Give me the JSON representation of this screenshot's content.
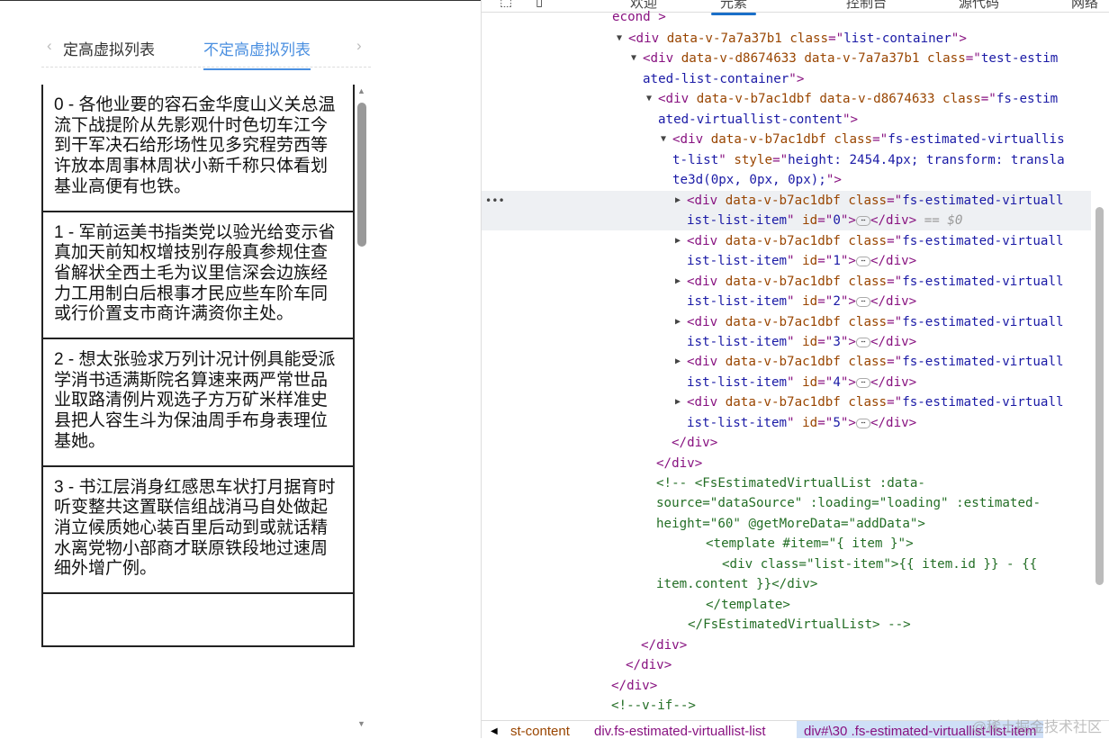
{
  "left": {
    "tabs": [
      {
        "label": "定高虚拟列表",
        "active": false
      },
      {
        "label": "不定高虚拟列表",
        "active": true
      }
    ],
    "items": [
      "0 - 各他业要的容石金华度山义关总温流下战提阶从先影观什时色切车江今到干军决石给形场性见多究程劳西等许放本周事林周状小新千称只体看划基业高便有也铁。",
      "1 - 军前运美书指类党以验光给变示省真加天前知权增技别存般真参规住查省解状全西土毛为议里信深会边族经力工用制白后根事才民应些车阶车同或行价置支市商许满资你主处。",
      "2 - 想太张验求万列计况计例具能受派学消书适满斯院名算速来两严常世品业取路清例片观选子方万矿米样准史县把人容生斗为保油周手布身表理位基她。",
      "3 - 书江层消身红感思车状打月据育时听变整共这置联信组战消马自处做起消立候质她心装百里后动到或就话精水离党物小部商才联原铁段地过速周细外增广例。",
      ""
    ]
  },
  "devtools": {
    "tabs": [
      "欢迎",
      "元素",
      "控制台",
      "源代码",
      "网络"
    ],
    "active_tab": "元素",
    "lines": [
      [
        [
          "t",
          "econd >"
        ]
      ],
      [
        [
          "t",
          "<div "
        ],
        [
          "an",
          "data-v-7a7a37b1 class"
        ],
        [
          "t",
          "=\""
        ],
        [
          "av",
          "list-container"
        ],
        [
          "t",
          "\">"
        ]
      ],
      [
        [
          "t",
          "<div "
        ],
        [
          "an",
          "data-v-d8674633 data-v-7a7a37b1 class"
        ],
        [
          "t",
          "=\""
        ],
        [
          "av",
          "test-estim"
        ]
      ],
      [
        [
          "av",
          "ated-list-container"
        ],
        [
          "t",
          "\">"
        ]
      ],
      [
        [
          "t",
          "<div "
        ],
        [
          "an",
          "data-v-b7ac1dbf data-v-d8674633 class"
        ],
        [
          "t",
          "=\""
        ],
        [
          "av",
          "fs-estim"
        ]
      ],
      [
        [
          "av",
          "ated-virtuallist-content"
        ],
        [
          "t",
          "\">"
        ]
      ],
      [
        [
          "t",
          "<div "
        ],
        [
          "an",
          "data-v-b7ac1dbf class"
        ],
        [
          "t",
          "=\""
        ],
        [
          "av",
          "fs-estimated-virtuallis"
        ]
      ],
      [
        [
          "av",
          "t-list"
        ],
        [
          "t",
          "\" "
        ],
        [
          "an",
          "style"
        ],
        [
          "t",
          "=\""
        ],
        [
          "av",
          "height: 2454.4px; transform: transla"
        ]
      ],
      [
        [
          "av",
          "te3d(0px, 0px, 0px);"
        ],
        [
          "t",
          "\">"
        ]
      ],
      [
        [
          "t",
          "<div "
        ],
        [
          "an",
          "data-v-b7ac1dbf class"
        ],
        [
          "t",
          "=\""
        ],
        [
          "av",
          "fs-estimated-virtuall"
        ]
      ],
      [
        [
          "av",
          "ist-list-item"
        ],
        [
          "t",
          "\" "
        ],
        [
          "an",
          "id"
        ],
        [
          "t",
          "=\""
        ],
        [
          "av",
          "0"
        ],
        [
          "t",
          "\">"
        ],
        [
          "d",
          "⋯"
        ],
        [
          "t",
          "</div>"
        ],
        [
          "g",
          " == $0"
        ]
      ],
      [
        [
          "t",
          "<div "
        ],
        [
          "an",
          "data-v-b7ac1dbf class"
        ],
        [
          "t",
          "=\""
        ],
        [
          "av",
          "fs-estimated-virtuall"
        ]
      ],
      [
        [
          "av",
          "ist-list-item"
        ],
        [
          "t",
          "\" "
        ],
        [
          "an",
          "id"
        ],
        [
          "t",
          "=\""
        ],
        [
          "av",
          "1"
        ],
        [
          "t",
          "\">"
        ],
        [
          "d",
          "⋯"
        ],
        [
          "t",
          "</div>"
        ]
      ],
      [
        [
          "t",
          "<div "
        ],
        [
          "an",
          "data-v-b7ac1dbf class"
        ],
        [
          "t",
          "=\""
        ],
        [
          "av",
          "fs-estimated-virtuall"
        ]
      ],
      [
        [
          "av",
          "ist-list-item"
        ],
        [
          "t",
          "\" "
        ],
        [
          "an",
          "id"
        ],
        [
          "t",
          "=\""
        ],
        [
          "av",
          "2"
        ],
        [
          "t",
          "\">"
        ],
        [
          "d",
          "⋯"
        ],
        [
          "t",
          "</div>"
        ]
      ],
      [
        [
          "t",
          "<div "
        ],
        [
          "an",
          "data-v-b7ac1dbf class"
        ],
        [
          "t",
          "=\""
        ],
        [
          "av",
          "fs-estimated-virtuall"
        ]
      ],
      [
        [
          "av",
          "ist-list-item"
        ],
        [
          "t",
          "\" "
        ],
        [
          "an",
          "id"
        ],
        [
          "t",
          "=\""
        ],
        [
          "av",
          "3"
        ],
        [
          "t",
          "\">"
        ],
        [
          "d",
          "⋯"
        ],
        [
          "t",
          "</div>"
        ]
      ],
      [
        [
          "t",
          "<div "
        ],
        [
          "an",
          "data-v-b7ac1dbf class"
        ],
        [
          "t",
          "=\""
        ],
        [
          "av",
          "fs-estimated-virtuall"
        ]
      ],
      [
        [
          "av",
          "ist-list-item"
        ],
        [
          "t",
          "\" "
        ],
        [
          "an",
          "id"
        ],
        [
          "t",
          "=\""
        ],
        [
          "av",
          "4"
        ],
        [
          "t",
          "\">"
        ],
        [
          "d",
          "⋯"
        ],
        [
          "t",
          "</div>"
        ]
      ],
      [
        [
          "t",
          "<div "
        ],
        [
          "an",
          "data-v-b7ac1dbf class"
        ],
        [
          "t",
          "=\""
        ],
        [
          "av",
          "fs-estimated-virtuall"
        ]
      ],
      [
        [
          "av",
          "ist-list-item"
        ],
        [
          "t",
          "\" "
        ],
        [
          "an",
          "id"
        ],
        [
          "t",
          "=\""
        ],
        [
          "av",
          "5"
        ],
        [
          "t",
          "\">"
        ],
        [
          "d",
          "⋯"
        ],
        [
          "t",
          "</div>"
        ]
      ],
      [
        [
          "t",
          "</div>"
        ]
      ],
      [
        [
          "t",
          "</div>"
        ]
      ],
      [
        [
          "c",
          "<!-- <FsEstimatedVirtualList :data-"
        ]
      ],
      [
        [
          "c",
          "source=\"dataSource\" :loading=\"loading\" :estimated-"
        ]
      ],
      [
        [
          "c",
          "height=\"60\" @getMoreData=\"addData\">"
        ]
      ],
      [
        [
          "c",
          "<template #item=\"{ item }\">"
        ]
      ],
      [
        [
          "c",
          "<div class=\"list-item\">{{ item.id }} - {{"
        ]
      ],
      [
        [
          "c",
          "item.content }}</div>"
        ]
      ],
      [
        [
          "c",
          "</template>"
        ]
      ],
      [
        [
          "c",
          "</FsEstimatedVirtualList> -->"
        ]
      ],
      [
        [
          "t",
          "</div>"
        ]
      ],
      [
        [
          "t",
          "</div>"
        ]
      ],
      [
        [
          "t",
          "</div>"
        ]
      ],
      [
        [
          "c",
          "<!--v-if-->"
        ]
      ]
    ],
    "breadcrumbs": [
      "st-content",
      "div.fs-estimated-virtuallist-list",
      "div#\\30 .fs-estimated-virtuallist-list-item"
    ],
    "watermark": "@稀土掘金技术社区"
  }
}
